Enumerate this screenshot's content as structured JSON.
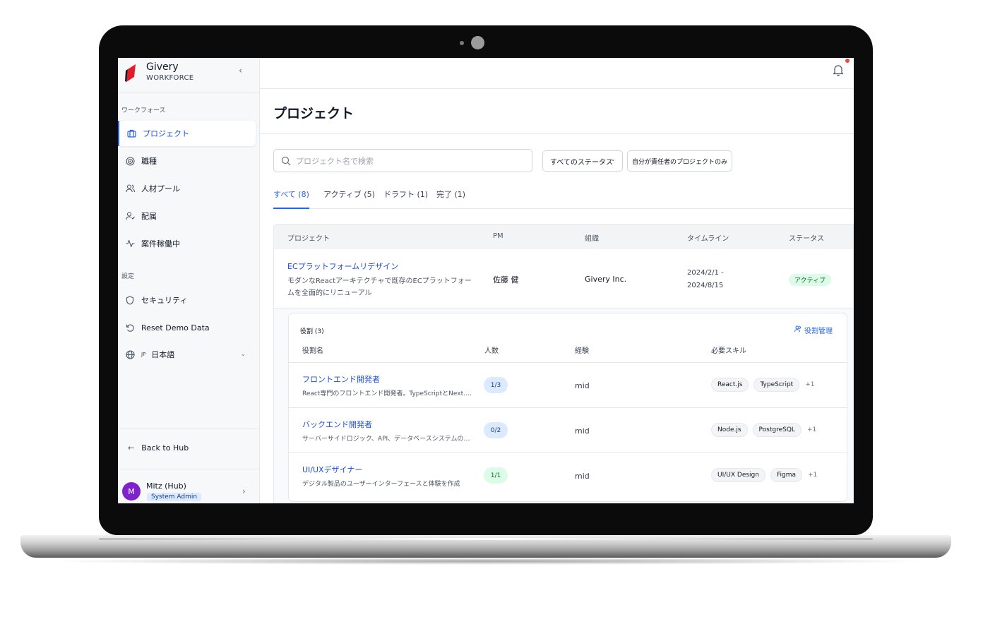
{
  "brand": {
    "name": "Givery",
    "sub": "WORKFORCE",
    "logo_color": "#e11d2a"
  },
  "sidebar": {
    "section_workforce": "ワークフォース",
    "items": [
      {
        "label": "プロジェクト",
        "icon": "briefcase-icon"
      },
      {
        "label": "職種",
        "icon": "target-icon"
      },
      {
        "label": "人材プール",
        "icon": "users-icon"
      },
      {
        "label": "配属",
        "icon": "user-check-icon"
      },
      {
        "label": "案件稼働中",
        "icon": "activity-icon"
      }
    ],
    "section_settings": "設定",
    "settings_items": [
      {
        "label": "セキュリティ",
        "icon": "shield-icon"
      },
      {
        "label": "Reset Demo Data",
        "icon": "refresh-icon"
      }
    ],
    "language": {
      "code": "JP",
      "label": "日本語"
    },
    "back_label": "Back to Hub",
    "user": {
      "initial": "M",
      "name": "Mitz (Hub)",
      "role": "System Admin"
    }
  },
  "main": {
    "title": "プロジェクト",
    "search_placeholder": "プロジェクト名で検索",
    "status_filter": "すべてのステータス",
    "mine_only": "自分が責任者のプロジェクトのみ",
    "tabs": [
      {
        "label": "すべて (8)",
        "active": true
      },
      {
        "label": "アクティブ (5)"
      },
      {
        "label": "ドラフト (1)"
      },
      {
        "label": "完了 (1)"
      }
    ],
    "table": {
      "headers": [
        "プロジェクト",
        "PM",
        "組織",
        "タイムライン",
        "ステータス"
      ],
      "rows": [
        {
          "name": "ECプラットフォームリデザイン",
          "description": "モダンなReactアーキテクチャで既存のECプラットフォームを全面的にリニューアル",
          "pm": "佐藤 健",
          "org": "Givery Inc.",
          "timeline": "2024/2/1 - 2024/8/15",
          "status": "アクティブ"
        }
      ]
    },
    "roles": {
      "title": "役割 (3)",
      "manage_label": "役割管理",
      "headers": [
        "役割名",
        "人数",
        "経験",
        "必要スキル"
      ],
      "rows": [
        {
          "name": "フロントエンド開発者",
          "description": "React専門のフロントエンド開発者。TypeScriptとNext.jsの経験者",
          "count": "1/3",
          "exp": "mid",
          "skills": [
            "React.js",
            "TypeScript"
          ],
          "more": "+1"
        },
        {
          "name": "バックエンド開発者",
          "description": "サーバーサイドロジック、API、データベースシステムの開発",
          "count": "0/2",
          "exp": "mid",
          "skills": [
            "Node.js",
            "PostgreSQL"
          ],
          "more": "+1"
        },
        {
          "name": "UI/UXデザイナー",
          "description": "デジタル製品のユーザーインターフェースと体験を作成",
          "count": "1/1",
          "exp": "mid",
          "skills": [
            "UI/UX Design",
            "Figma"
          ],
          "more": "+1"
        }
      ]
    }
  }
}
